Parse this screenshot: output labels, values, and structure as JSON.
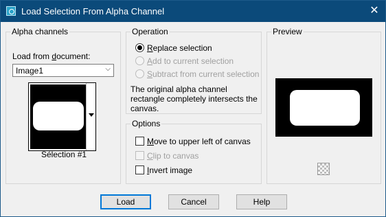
{
  "window": {
    "title": "Load Selection From Alpha Channel",
    "close_glyph": "✕",
    "accent": "#0b4a7a"
  },
  "alpha": {
    "group_title": "Alpha channels",
    "load_from_label_pre": "Load from ",
    "load_from_label_u": "d",
    "load_from_label_post": "ocument:",
    "document_value": "Image1",
    "channel_name": "Sélection #1"
  },
  "operation": {
    "group_title": "Operation",
    "options": [
      {
        "u": "R",
        "rest": "eplace selection",
        "selected": true,
        "enabled": true
      },
      {
        "u": "A",
        "rest": "dd to current selection",
        "selected": false,
        "enabled": false
      },
      {
        "u": "S",
        "rest": "ubtract from current selection",
        "selected": false,
        "enabled": false
      }
    ],
    "message_line1": "The original alpha channel",
    "message_line2": "rectangle completely intersects the",
    "message_line3": "canvas."
  },
  "options": {
    "group_title": "Options",
    "items": [
      {
        "u": "M",
        "rest": "ove to upper left of canvas",
        "checked": false,
        "enabled": true
      },
      {
        "u": "C",
        "rest": "lip to canvas",
        "checked": false,
        "enabled": false
      },
      {
        "u": "I",
        "rest": "nvert image",
        "checked": false,
        "enabled": true
      }
    ]
  },
  "preview": {
    "group_title": "Preview"
  },
  "buttons": {
    "load": "Load",
    "cancel": "Cancel",
    "help": "Help"
  }
}
